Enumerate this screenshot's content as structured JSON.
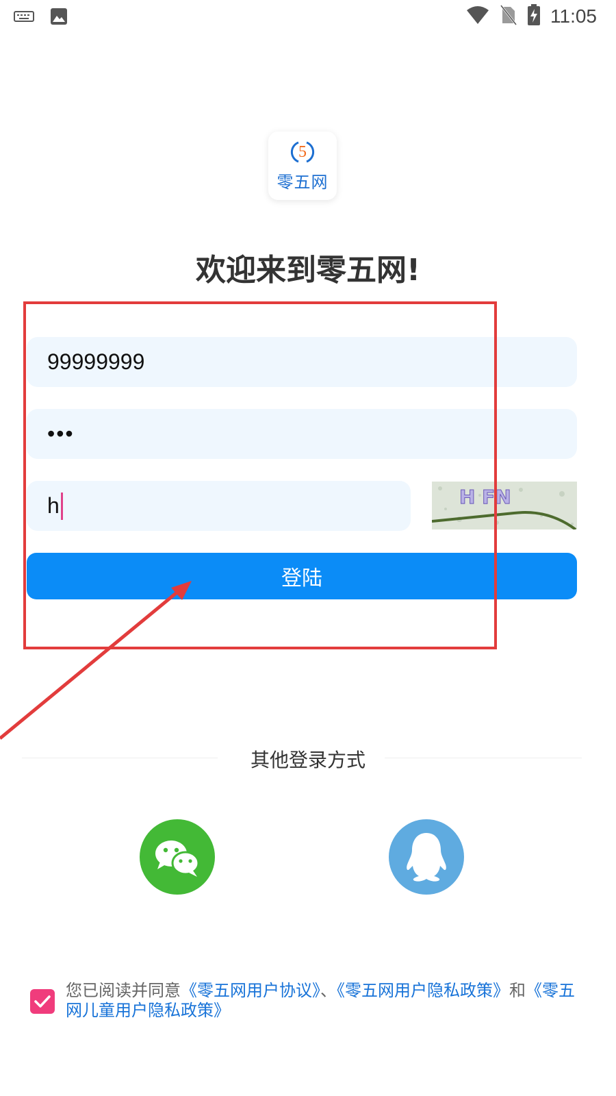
{
  "status_bar": {
    "time": "11:05",
    "icons": [
      "keyboard-icon",
      "image-icon",
      "wifi-icon",
      "no-sim-icon",
      "battery-charging-icon"
    ]
  },
  "logo": {
    "digit": "5",
    "name": "零五网"
  },
  "welcome_title": "欢迎来到零五网!",
  "form": {
    "username_value": "99999999",
    "password_value": "•••",
    "captcha_value": "h",
    "captcha_image_text": "H FN",
    "login_label": "登陆"
  },
  "other_login": {
    "title": "其他登录方式",
    "methods": [
      "wechat-icon",
      "qq-icon"
    ]
  },
  "agreement": {
    "checked": true,
    "prefix": "您已阅读并同意",
    "link1": "《零五网用户协议》",
    "sep1": "、",
    "link2": "《零五网用户隐私政策》",
    "sep2": "和",
    "link3": "《零五网儿童用户隐私政策》"
  },
  "colors": {
    "primary": "#0b8cf7",
    "annotation": "#e23c3c",
    "wechat": "#43b936",
    "qq": "#5fabe0",
    "checkbox": "#f03c7c",
    "link": "#1873d8"
  }
}
